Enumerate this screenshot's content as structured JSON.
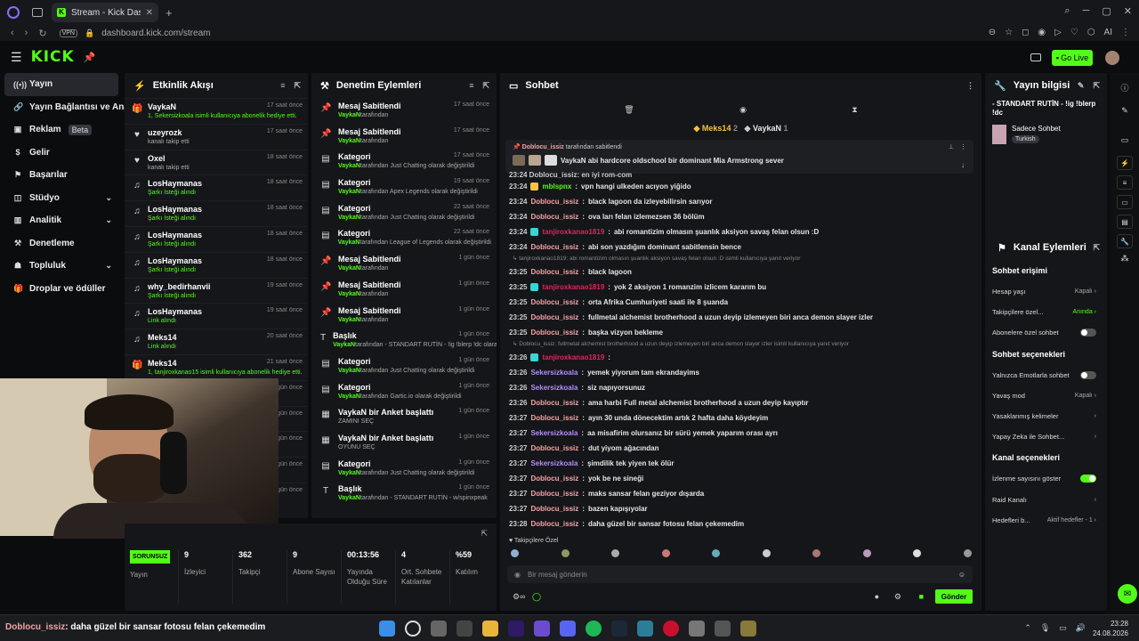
{
  "browser": {
    "tab_title": "Stream - Kick Dashboard",
    "url": "dashboard.kick.com/stream",
    "vpn": "VPN",
    "ext_ai": "AI"
  },
  "header": {
    "logo": "KICK",
    "go_live": "Go Live"
  },
  "sidebar": {
    "items": [
      {
        "label": "Yayın",
        "icon": "stream-icon",
        "active": true
      },
      {
        "label": "Yayın Bağlantısı ve Anahtar",
        "icon": "link-icon"
      },
      {
        "label": "Reklam",
        "icon": "ad-icon",
        "badge": "Beta"
      },
      {
        "label": "Gelir",
        "icon": "money-icon"
      },
      {
        "label": "Başarılar",
        "icon": "flag-icon"
      },
      {
        "label": "Stüdyo",
        "icon": "studio-icon",
        "chevron": true
      },
      {
        "label": "Analitik",
        "icon": "chart-icon",
        "chevron": true
      },
      {
        "label": "Denetleme",
        "icon": "hammer-icon"
      },
      {
        "label": "Topluluk",
        "icon": "community-icon",
        "chevron": true
      },
      {
        "label": "Droplar ve ödüller",
        "icon": "gift-icon"
      }
    ]
  },
  "events": {
    "title": "Etkinlik Akışı",
    "items": [
      {
        "name": "VaykaN",
        "desc": "1, Sekersizkoala isimli kullanıcıya abonelik hediye etti.",
        "time": "17 saat önce",
        "icon": "gift-icon",
        "green": true
      },
      {
        "name": "uzeyrozk",
        "desc": "kanalı takip etti",
        "time": "17 saat önce",
        "icon": "heart-icon"
      },
      {
        "name": "Oxel",
        "desc": "kanalı takip etti",
        "time": "18 saat önce",
        "icon": "heart-icon"
      },
      {
        "name": "LosHaymanas",
        "desc": "Şarkı İsteği alındı",
        "time": "18 saat önce",
        "icon": "music-icon",
        "green": true
      },
      {
        "name": "LosHaymanas",
        "desc": "Şarkı İsteği alındı",
        "time": "18 saat önce",
        "icon": "music-icon",
        "green": true
      },
      {
        "name": "LosHaymanas",
        "desc": "Şarkı İsteği alındı",
        "time": "18 saat önce",
        "icon": "music-icon",
        "green": true
      },
      {
        "name": "LosHaymanas",
        "desc": "Şarkı İsteği alındı",
        "time": "18 saat önce",
        "icon": "music-icon",
        "green": true
      },
      {
        "name": "why_bedirhanvii",
        "desc": "Şarkı İsteği alındı",
        "time": "19 saat önce",
        "icon": "music-icon",
        "green": true
      },
      {
        "name": "LosHaymanas",
        "desc": "Link alındı",
        "time": "19 saat önce",
        "icon": "music-icon",
        "green": true
      },
      {
        "name": "Meks14",
        "desc": "Link alındı",
        "time": "20 saat önce",
        "icon": "music-icon",
        "green": true
      },
      {
        "name": "Meks14",
        "desc": "1, tanjiroxkanao15 isimli kullanıcıya abonelik hediye etti.",
        "time": "21 saat önce",
        "icon": "gift-icon",
        "green": true
      },
      {
        "name": "",
        "desc": "",
        "time": "1 gün önce",
        "icon": ""
      },
      {
        "name": "",
        "desc": "",
        "time": "1 gün önce",
        "icon": ""
      },
      {
        "name": "",
        "desc": "",
        "time": "1 gün önce",
        "icon": ""
      },
      {
        "name": "",
        "desc": "",
        "time": "1 gün önce",
        "icon": ""
      },
      {
        "name": "",
        "desc": "",
        "time": "1 gün önce",
        "icon": ""
      }
    ]
  },
  "moderation": {
    "title": "Denetim Eylemleri",
    "items": [
      {
        "name": "Mesaj Sabitlendi",
        "user": "VaykaN",
        "rest": "tarafından",
        "time": "17 saat önce",
        "icon": "pin-icon"
      },
      {
        "name": "Mesaj Sabitlendi",
        "user": "VaykaN",
        "rest": "tarafından",
        "time": "17 saat önce",
        "icon": "pin-icon"
      },
      {
        "name": "Kategori",
        "user": "VaykaN",
        "rest": "tarafından Just Chatting olarak değiştirildi",
        "time": "17 saat önce",
        "icon": "category-icon"
      },
      {
        "name": "Kategori",
        "user": "VaykaN",
        "rest": "tarafından Apex Legends olarak değiştirildi",
        "time": "19 saat önce",
        "icon": "category-icon"
      },
      {
        "name": "Kategori",
        "user": "VaykaN",
        "rest": "tarafından Just Chatting olarak değiştirildi",
        "time": "22 saat önce",
        "icon": "category-icon"
      },
      {
        "name": "Kategori",
        "user": "VaykaN",
        "rest": "tarafından League of Legends olarak değiştirildi",
        "time": "22 saat önce",
        "icon": "category-icon"
      },
      {
        "name": "Mesaj Sabitlendi",
        "user": "VaykaN",
        "rest": "tarafından",
        "time": "1 gün önce",
        "icon": "pin-icon"
      },
      {
        "name": "Mesaj Sabitlendi",
        "user": "VaykaN",
        "rest": "tarafından",
        "time": "1 gün önce",
        "icon": "pin-icon"
      },
      {
        "name": "Mesaj Sabitlendi",
        "user": "VaykaN",
        "rest": "tarafından",
        "time": "1 gün önce",
        "icon": "pin-icon"
      },
      {
        "name": "Başlık",
        "user": "VaykaN",
        "rest": "tarafından - STANDART RUTİN - !ig !blerp !dc olarak değiştirildi",
        "time": "1 gün önce",
        "icon": "title-icon"
      },
      {
        "name": "Kategori",
        "user": "VaykaN",
        "rest": "tarafından Just Chatting olarak değiştirildi",
        "time": "1 gün önce",
        "icon": "category-icon"
      },
      {
        "name": "Kategori",
        "user": "VaykaN",
        "rest": "tarafından Gartic.io olarak değiştirildi",
        "time": "1 gün önce",
        "icon": "category-icon"
      },
      {
        "name": "VaykaN bir Anket başlattı",
        "user": "",
        "rest": "ZAMINI SEÇ",
        "time": "1 gün önce",
        "icon": "poll-icon"
      },
      {
        "name": "VaykaN bir Anket başlattı",
        "user": "",
        "rest": "OYUNU SEÇ",
        "time": "1 gün önce",
        "icon": "poll-icon"
      },
      {
        "name": "Kategori",
        "user": "VaykaN",
        "rest": "tarafından Just Chatting olarak değiştirildi",
        "time": "1 gün önce",
        "icon": "category-icon"
      },
      {
        "name": "Başlık",
        "user": "VaykaN",
        "rest": "tarafından - STANDART RUTİN - w/spinxpeak",
        "time": "1 gün önce",
        "icon": "title-icon"
      }
    ]
  },
  "stats": {
    "status": "SORUNSUZ",
    "status_label": "Yayın",
    "cells": [
      {
        "value": "9",
        "label": "İzleyici"
      },
      {
        "value": "362",
        "label": "Takipçi"
      },
      {
        "value": "9",
        "label": "Abone Sayısı"
      },
      {
        "value": "00:13:56",
        "label": "Yayında Olduğu Süre"
      },
      {
        "value": "4",
        "label": "Ort. Sohbete Katılanlar"
      },
      {
        "value": "%59",
        "label": "Katılım"
      }
    ]
  },
  "chat": {
    "title": "Sohbet",
    "viewer1": "Meks14",
    "viewer1_count": "2",
    "viewer2": "VaykaN",
    "viewer2_count": "1",
    "pinned_by": "Doblocu_issiz",
    "pinned_by_rest": "tarafından sabitlendi",
    "pinned_msg": "VaykaN abi hardcore oldschool bir dominant Mia Armstrong sever",
    "partial": "23:24 Doblocu_issiz: en iyi rom-com",
    "messages": [
      {
        "time": "23:24",
        "user": "mblspnx",
        "color": "#53fc18",
        "text": "vpn hangi ulkeden acıyon yiğido",
        "badge": "#f5c346"
      },
      {
        "time": "23:24",
        "user": "Doblocu_issiz",
        "color": "#f3a5a5",
        "text": "black lagoon da izleyebilirsin sarıyor"
      },
      {
        "time": "23:24",
        "user": "Doblocu_issiz",
        "color": "#f3a5a5",
        "text": "ova ları felan izlemezsen 36 bölüm"
      },
      {
        "time": "23:24",
        "user": "tanjiroxkanao1819",
        "color": "#e0245e",
        "text": "abi romantizim olmasın şuanlık aksiyon savaş felan olsun :D",
        "badge": "#3ad4d4"
      },
      {
        "time": "23:24",
        "user": "Doblocu_issiz",
        "color": "#f3a5a5",
        "text": "abi son yazdığım dominant sabitlensin bence"
      },
      {
        "reply": "↳ tanjiroxkanao1819: abi romantizim olmasın şuanlık aksiyon savaş felan olsun :D isimli kullanıcıya yanıt veriyor"
      },
      {
        "time": "23:25",
        "user": "Doblocu_issiz",
        "color": "#f3a5a5",
        "text": "black lagoon"
      },
      {
        "time": "23:25",
        "user": "tanjiroxkanao1819",
        "color": "#e0245e",
        "text": "yok 2 aksiyon 1 romanzim izlicem kararım bu",
        "badge": "#3ad4d4"
      },
      {
        "time": "23:25",
        "user": "Doblocu_issiz",
        "color": "#f3a5a5",
        "text": "orta Afrika Cumhuriyeti saati ile 8 şuanda"
      },
      {
        "time": "23:25",
        "user": "Doblocu_issiz",
        "color": "#f3a5a5",
        "text": "fullmetal alchemist brotherhood a uzun deyip izlemeyen biri anca demon slayer izler"
      },
      {
        "time": "23:25",
        "user": "Doblocu_issiz",
        "color": "#f3a5a5",
        "text": "başka vizyon bekleme"
      },
      {
        "reply": "↳ Doblocu_issiz: fullmetal alchemist brotherhood a uzun deyip izlemeyen biri anca demon slayer izler isimli kullanıcıya yanıt veriyor"
      },
      {
        "time": "23:26",
        "user": "tanjiroxkanao1819",
        "color": "#e0245e",
        "text": "",
        "badge": "#3ad4d4"
      },
      {
        "time": "23:26",
        "user": "Sekersizkoala",
        "color": "#b58cff",
        "text": "yemek yiyorum tam ekrandayims"
      },
      {
        "time": "23:26",
        "user": "Sekersizkoala",
        "color": "#b58cff",
        "text": "siz napıyorsunuz"
      },
      {
        "time": "23:26",
        "user": "Doblocu_issiz",
        "color": "#f3a5a5",
        "text": "ama harbi Full metal alchemist brotherhood a uzun deyip kayıptır"
      },
      {
        "time": "23:27",
        "user": "Doblocu_issiz",
        "color": "#f3a5a5",
        "text": "ayın 30 unda dönecektim artık 2 hafta daha köydeyim"
      },
      {
        "time": "23:27",
        "user": "Sekersizkoala",
        "color": "#b58cff",
        "text": "aa misafirim olursanız bir sürü yemek yaparım orası ayrı"
      },
      {
        "time": "23:27",
        "user": "Doblocu_issiz",
        "color": "#f3a5a5",
        "text": "dut yiyom ağacından"
      },
      {
        "time": "23:27",
        "user": "Sekersizkoala",
        "color": "#b58cff",
        "text": "şimdilik tek yiyen tek ölür"
      },
      {
        "time": "23:27",
        "user": "Doblocu_issiz",
        "color": "#f3a5a5",
        "text": "yok be ne sineği"
      },
      {
        "time": "23:27",
        "user": "Doblocu_issiz",
        "color": "#f3a5a5",
        "text": "maks sansar felan geziyor dışarda"
      },
      {
        "time": "23:27",
        "user": "Doblocu_issiz",
        "color": "#f3a5a5",
        "text": "bazen kapışıyolar"
      },
      {
        "time": "23:28",
        "user": "Doblocu_issiz",
        "color": "#f3a5a5",
        "text": "daha güzel bir sansar fotosu felan çekemedim"
      }
    ],
    "followers_only": "Takipçilere Özel",
    "placeholder": "Bir mesaj gönderin",
    "send": "Gönder"
  },
  "stream_info": {
    "title": "Yayın bilgisi",
    "stream_title": "- STANDART RUTİN - !ig !blerp !dc",
    "category": "Sadece Sohbet",
    "language": "Turkish"
  },
  "channel_actions": {
    "title": "Kanal Eylemleri",
    "sections": [
      {
        "heading": "Sohbet erişimi",
        "rows": [
          {
            "label": "Hesap yaşı",
            "value": "Kapalı"
          },
          {
            "label": "Takipçilere özel...",
            "value": "Anında",
            "green": true
          },
          {
            "label": "Abonelere özel sohbet",
            "toggle": "off"
          }
        ]
      },
      {
        "heading": "Sohbet seçenekleri",
        "rows": [
          {
            "label": "Yalnızca Emotlarla sohbet",
            "toggle": "off"
          },
          {
            "label": "Yavaş mod",
            "value": "Kapalı"
          },
          {
            "label": "Yasaklanmış kelimeler",
            "value": ""
          },
          {
            "label": "Yapay Zeka ile Sohbet...",
            "value": ""
          }
        ]
      },
      {
        "heading": "Kanal seçenekleri",
        "rows": [
          {
            "label": "İzlenme sayısını göster",
            "toggle": "on"
          },
          {
            "label": "Raid Kanalı",
            "value": ""
          },
          {
            "label": "Hedefleri b...",
            "value": "Aktif hedefler - 1"
          }
        ]
      }
    ]
  },
  "taskbar": {
    "ticker_user": "Doblocu_issiz",
    "ticker_text": ": daha güzel bir sansar fotosu felan çekemedim",
    "time": "23:28",
    "date": "24.08.2026"
  },
  "colors": {
    "accent": "#53fc18",
    "bg": "#0b0c0e",
    "panel": "#151619"
  }
}
